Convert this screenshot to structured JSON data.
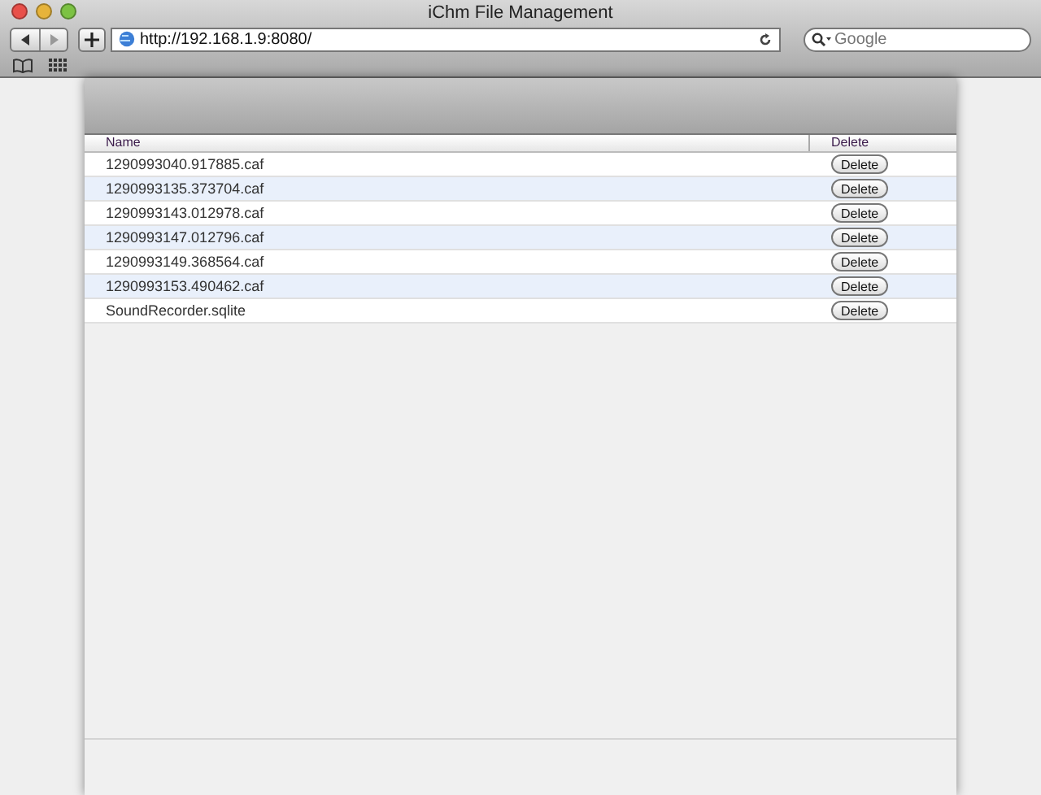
{
  "window": {
    "title": "iChm File Management"
  },
  "toolbar": {
    "url": "http://192.168.1.9:8080/",
    "search": {
      "placeholder": "Google"
    }
  },
  "table": {
    "columns": [
      "Name",
      "Delete"
    ],
    "rows": [
      {
        "name": "1290993040.917885.caf",
        "action": "Delete"
      },
      {
        "name": "1290993135.373704.caf",
        "action": "Delete"
      },
      {
        "name": "1290993143.012978.caf",
        "action": "Delete"
      },
      {
        "name": "1290993147.012796.caf",
        "action": "Delete"
      },
      {
        "name": "1290993149.368564.caf",
        "action": "Delete"
      },
      {
        "name": "1290993153.490462.caf",
        "action": "Delete"
      },
      {
        "name": "SoundRecorder.sqlite",
        "action": "Delete"
      }
    ]
  }
}
